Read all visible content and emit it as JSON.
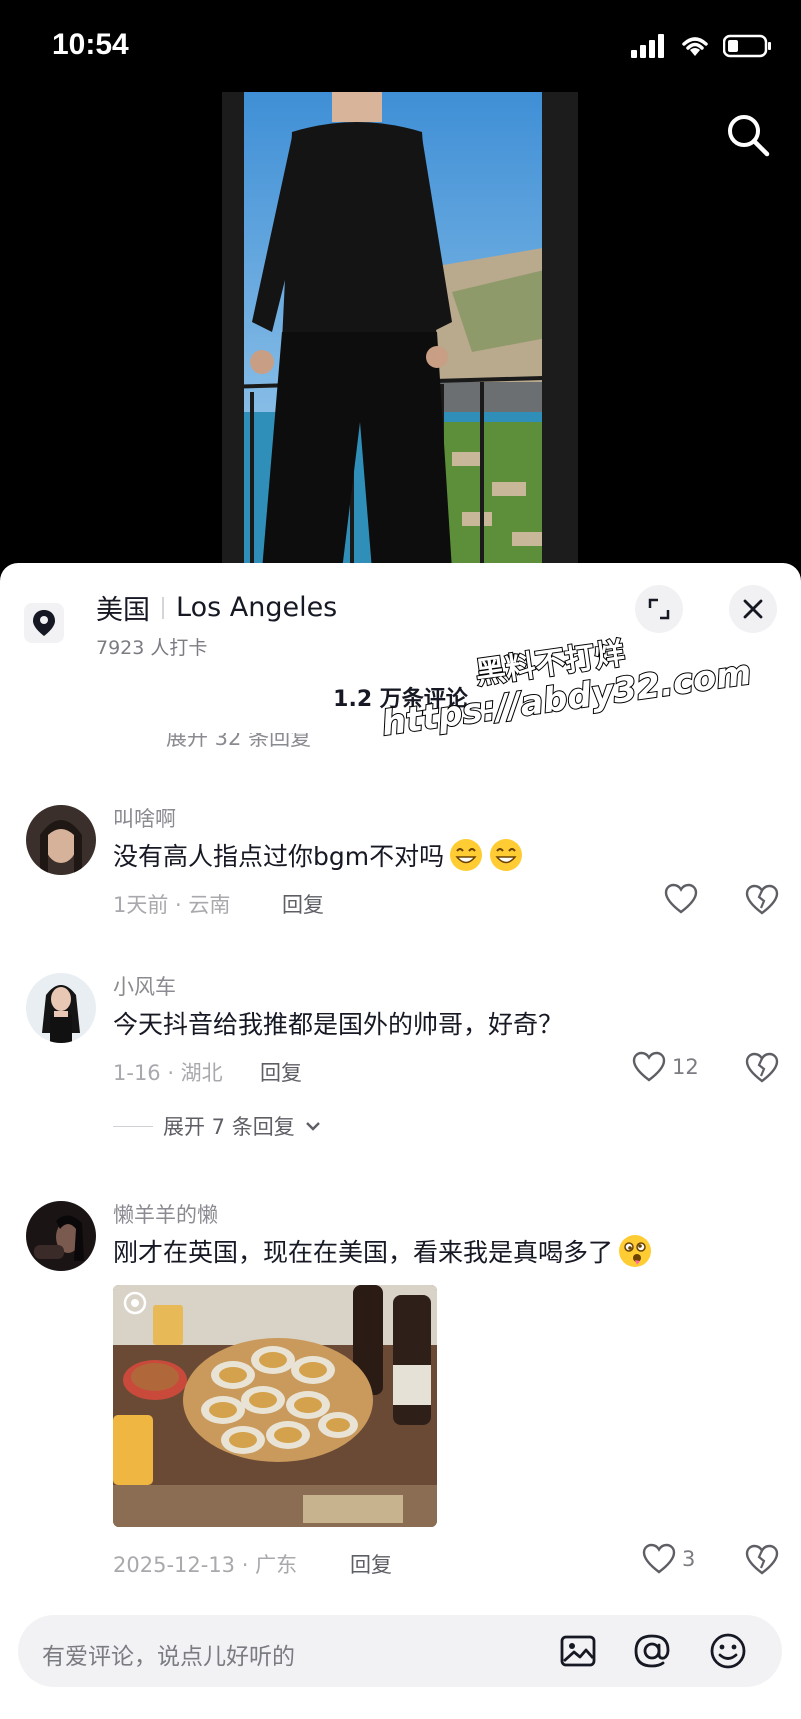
{
  "status": {
    "time": "10:54"
  },
  "location": {
    "country": "美国",
    "city": "Los Angeles",
    "checkins": "7923 人打卡"
  },
  "comments_header": {
    "count": "1.2 万条评论",
    "partial_expand": "展开 32 条回复"
  },
  "watermark": {
    "line1": "黑料不打烊",
    "line2": "https://abdy32.com"
  },
  "comments": [
    {
      "name": "叫啥啊",
      "text": "没有高人指点过你bgm不对吗",
      "meta": "1天前 · 云南",
      "reply": "回复",
      "likes": ""
    },
    {
      "name": "小风车",
      "text": "今天抖音给我推都是国外的帅哥，好奇？",
      "meta": "1-16 · 湖北",
      "reply": "回复",
      "likes": "12",
      "expand": "展开 7 条回复"
    },
    {
      "name": "懒羊羊的懒",
      "text": "刚才在英国，现在在美国，看来我是真喝多了",
      "meta": "2025-12-13 · 广东",
      "reply": "回复",
      "likes": "3"
    }
  ],
  "input": {
    "placeholder": "有爱评论，说点儿好听的"
  },
  "icons": {
    "search": "search-icon",
    "location": "location-pin-icon",
    "expand": "expand-icon",
    "close": "close-icon",
    "like": "heart-icon",
    "dislike": "broken-heart-icon",
    "image": "image-icon",
    "mention": "at-icon",
    "emoji": "emoji-icon"
  },
  "colors": {
    "sheet_bg": "#ffffff",
    "text_primary": "#161823",
    "text_secondary": "#8a8b91"
  }
}
